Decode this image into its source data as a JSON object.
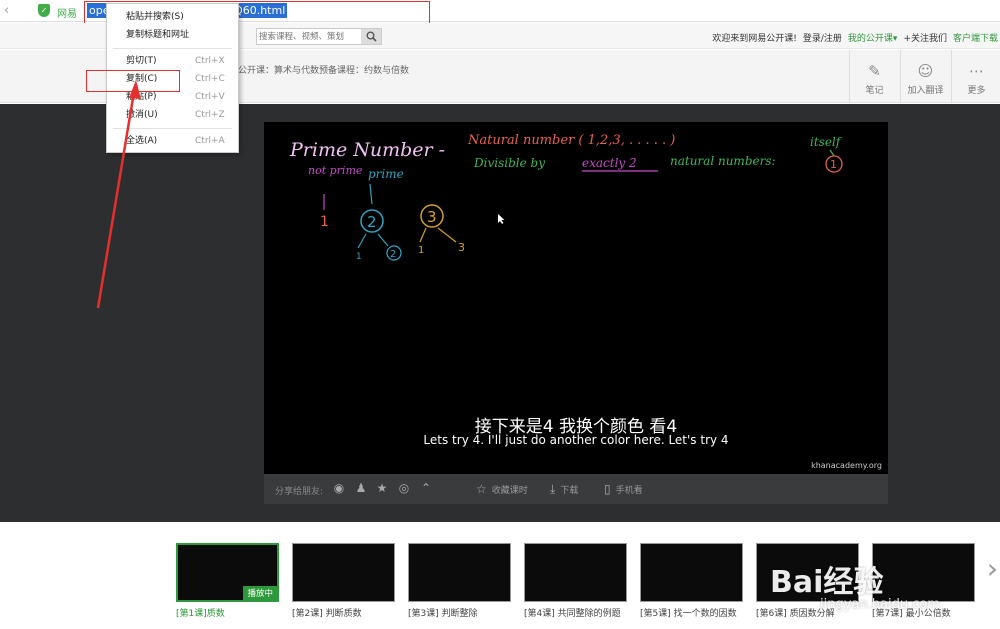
{
  "browser": {
    "site_label": "网易",
    "url_text": "ope                                   Y0/M8LI1JCE6_M8LI3BQ60.html"
  },
  "site_header": {
    "search_placeholder": "搜索课程、视频、策划",
    "links": [
      "欢迎来到网易公开课!",
      "登录/注册",
      "我的公开课▾",
      "+关注我们",
      "客户端下载"
    ]
  },
  "toolbar": {
    "breadcrumb": "公开课：算术与代数预备课程：约数与倍数",
    "tools": [
      {
        "icon": "pencil-icon",
        "label": "笔记"
      },
      {
        "icon": "translate-icon",
        "label": "加入翻译"
      },
      {
        "icon": "more-icon",
        "label": "更多"
      }
    ]
  },
  "context_menu": {
    "items": [
      {
        "label": "粘贴并搜索(S)",
        "shortcut": ""
      },
      {
        "label": "复制标题和网址",
        "shortcut": ""
      },
      {
        "label": "剪切(T)",
        "shortcut": "Ctrl+X"
      },
      {
        "label": "复制(C)",
        "shortcut": "Ctrl+C"
      },
      {
        "label": "粘贴(P)",
        "shortcut": "Ctrl+V"
      },
      {
        "label": "撤消(U)",
        "shortcut": "Ctrl+Z"
      },
      {
        "label": "全选(A)",
        "shortcut": "Ctrl+A"
      }
    ]
  },
  "video": {
    "board": {
      "title": "Prime Number -",
      "definition": "Natural number ( 1,2,3, . . . . . )",
      "divisible": "Divisible by",
      "exactly": "exactly 2",
      "natural_numbers": "natural numbers:",
      "itself": "itself",
      "not_prime": "not prime",
      "prime": "prime",
      "n1": "1",
      "n2": "2",
      "n3": "3",
      "one_small": "1",
      "n2_small": "2",
      "n1_b": "1",
      "n3_b": "3",
      "circled_1": "1"
    },
    "subtitle_cn": "接下来是4 我换个颜色 看4",
    "subtitle_en": "Lets try 4. I'll just do another color here. Let's try 4",
    "watermark": "khanacademy.org"
  },
  "controls": {
    "share_label": "分享给朋友:",
    "share_icons": [
      "wechat-icon",
      "qq-icon",
      "star-icon",
      "weibo-icon",
      "chevron-up-icon"
    ],
    "buttons": [
      {
        "icon": "star-icon",
        "label": "收藏课时"
      },
      {
        "icon": "download-icon",
        "label": "下载"
      },
      {
        "icon": "phone-icon",
        "label": "手机看"
      }
    ]
  },
  "lessons": {
    "playing_badge": "播放中",
    "items": [
      "[第1课]质数",
      "[第2课] 判断质数",
      "[第3课] 判断整除",
      "[第4课] 共同整除的例题",
      "[第5课] 找一个数的因数",
      "[第6课] 质因数分解",
      "[第7课] 最小公倍数"
    ],
    "active_index": 0
  },
  "overlay": {
    "baidu_logo": "Bai经验",
    "baidu_url": "jingyan.baidu.com"
  },
  "colors": {
    "accent_green": "#2c9a3a",
    "annotation_red": "#e52e2e",
    "selection_blue": "#2a6fd6",
    "stage_dark": "#2d2e30"
  }
}
